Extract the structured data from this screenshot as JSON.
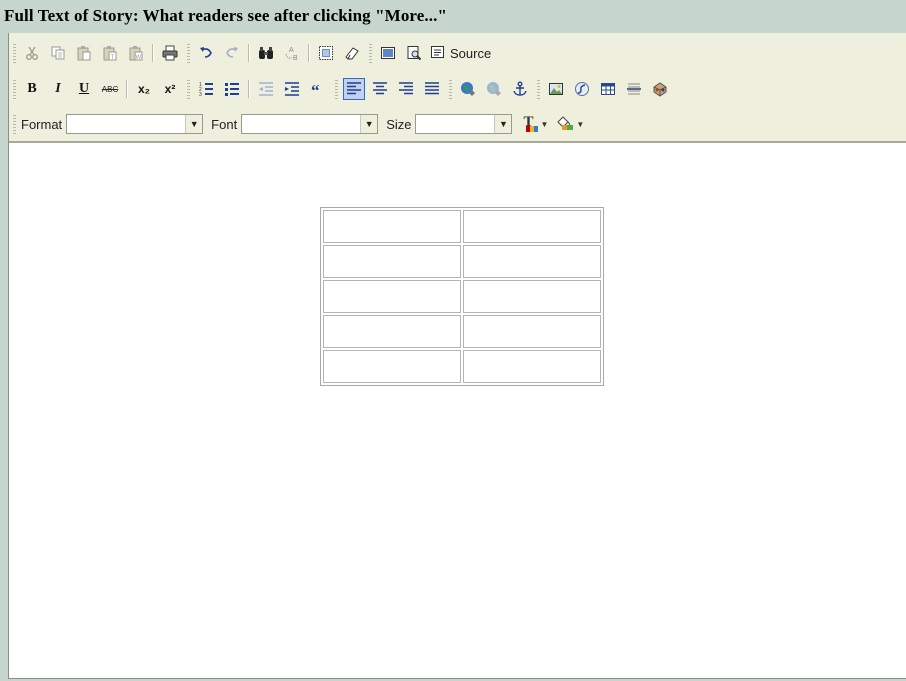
{
  "page": {
    "title": "Full Text of Story: What readers see after clicking \"More...\""
  },
  "toolbar": {
    "row1": {
      "cut": "cut-icon",
      "copy": "copy-icon",
      "paste": "paste-icon",
      "paste_text": "paste-text-icon",
      "paste_word": "paste-word-icon",
      "print": "print-icon",
      "undo": "undo-icon",
      "redo": "redo-icon",
      "find": "find-icon",
      "replace": "replace-icon",
      "select_all": "select-all-icon",
      "remove_format": "remove-format-icon",
      "template": "template-icon",
      "preview": "preview-icon",
      "source_label": "Source"
    },
    "row2": {
      "bold": "B",
      "italic": "I",
      "underline": "U",
      "strike": "ABC",
      "subscript": "x₂",
      "superscript": "x²",
      "active_alignment": "align-left"
    },
    "row3": {
      "format_label": "Format",
      "format_value": "",
      "font_label": "Font",
      "font_value": "",
      "size_label": "Size",
      "size_value": "",
      "text_color_glyph": "T",
      "text_color": "#c00000",
      "bg_color": "#e89d1b"
    }
  },
  "content": {
    "table": {
      "rows": [
        [
          "",
          ""
        ],
        [
          "",
          ""
        ],
        [
          "",
          ""
        ],
        [
          "",
          ""
        ],
        [
          "",
          ""
        ]
      ]
    }
  },
  "colors": {
    "chrome": "#c6d6cc",
    "toolbar": "#efefde",
    "active_button": "#c1d2ee",
    "active_border": "#316ac5"
  }
}
